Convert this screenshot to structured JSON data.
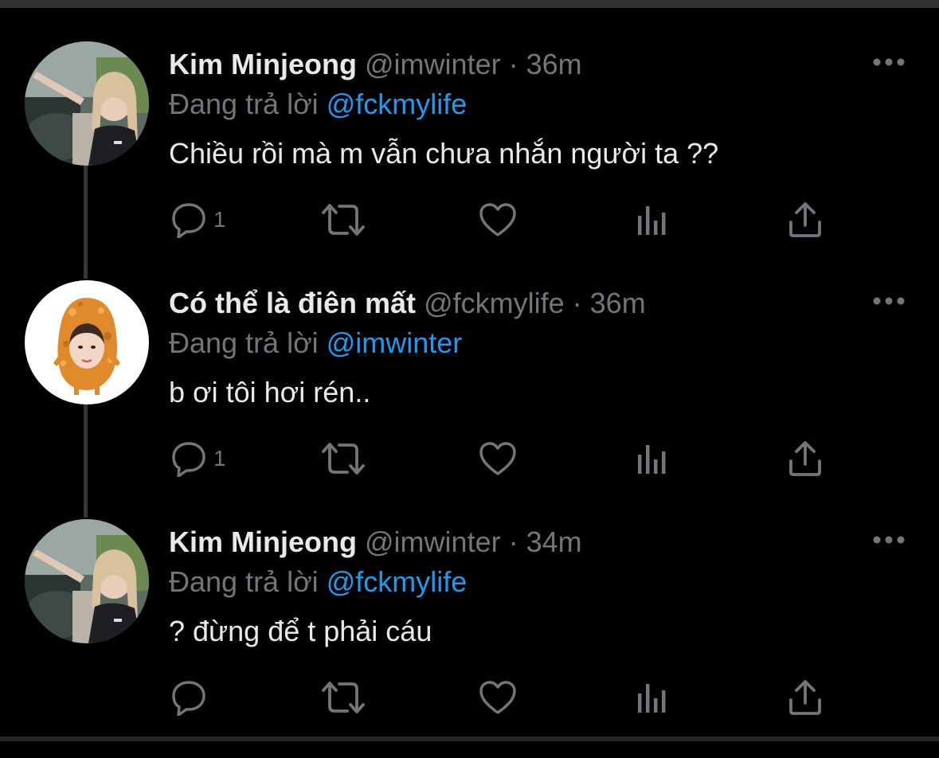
{
  "tweets": [
    {
      "name": "Kim Minjeong",
      "handle": "@imwinter",
      "separator": "·",
      "time": "36m",
      "reply_prefix": "Đang trả lời",
      "reply_to": "@fckmylife",
      "text": "Chiều rồi mà m vẫn chưa nhắn người ta ??",
      "reply_count": "1",
      "avatar": "photo-avatar"
    },
    {
      "name": "Có thể là điên mất",
      "handle": "@fckmylife",
      "separator": "·",
      "time": "36m",
      "reply_prefix": "Đang trả lời",
      "reply_to": "@imwinter",
      "text": "b ơi tôi hơi rén..",
      "reply_count": "1",
      "avatar": "nugget-avatar"
    },
    {
      "name": "Kim Minjeong",
      "handle": "@imwinter",
      "separator": "·",
      "time": "34m",
      "reply_prefix": "Đang trả lời",
      "reply_to": "@fckmylife",
      "text": "? đừng để t phải cáu",
      "reply_count": "",
      "avatar": "photo-avatar"
    }
  ],
  "icons": [
    "reply-icon",
    "retweet-icon",
    "like-icon",
    "views-icon",
    "share-icon",
    "more-icon"
  ],
  "colors": {
    "background": "#000000",
    "text": "#e7e9ea",
    "muted": "#71767b",
    "link": "#1d9bf0",
    "thread": "#333639"
  }
}
